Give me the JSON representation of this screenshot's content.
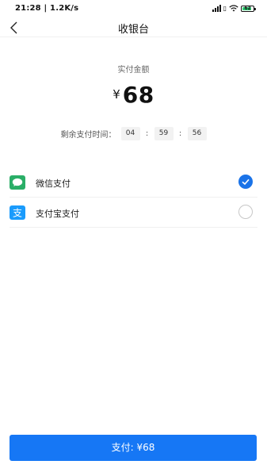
{
  "status_bar": {
    "time": "21:28 | 1.2K/s",
    "battery": "62"
  },
  "header": {
    "title": "收银台"
  },
  "amount": {
    "label": "实付金额",
    "currency": "¥",
    "value": "68"
  },
  "countdown": {
    "label": "剩余支付时间：",
    "hours": "04",
    "minutes": "59",
    "seconds": "56",
    "separator": ":"
  },
  "payment_methods": [
    {
      "name": "微信支付",
      "icon": "wechat-pay-icon",
      "selected": true,
      "color": "#2aae67"
    },
    {
      "name": "支付宝支付",
      "icon": "alipay-icon",
      "selected": false,
      "color": "#1a9bfc"
    }
  ],
  "pay_button": {
    "label": "支付: ¥68"
  },
  "colors": {
    "accent": "#1677f5"
  }
}
